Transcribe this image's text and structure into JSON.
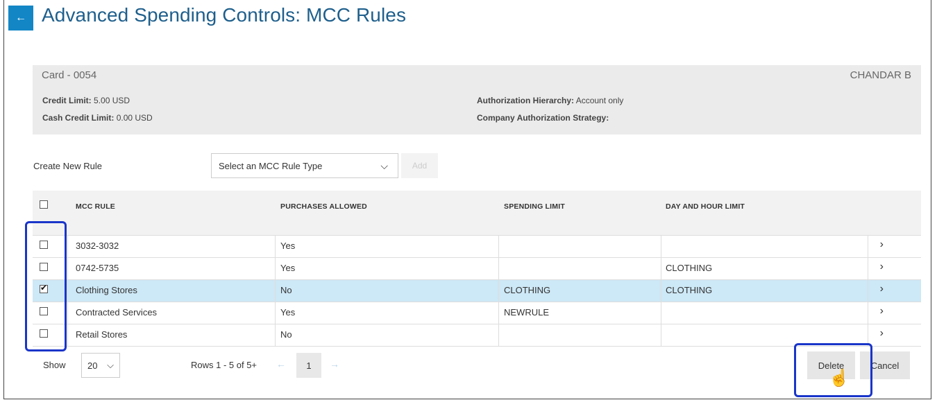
{
  "header": {
    "back_icon": "←",
    "title": "Advanced Spending Controls: MCC Rules"
  },
  "card": {
    "title": "Card - 0054",
    "holder": "CHANDAR B",
    "credit_limit_label": "Credit Limit:",
    "credit_limit_value": "5.00 USD",
    "cash_credit_limit_label": "Cash Credit Limit:",
    "cash_credit_limit_value": "0.00 USD",
    "auth_hierarchy_label": "Authorization Hierarchy:",
    "auth_hierarchy_value": "Account only",
    "company_strategy_label": "Company Authorization Strategy:",
    "company_strategy_value": ""
  },
  "create_rule": {
    "label": "Create New Rule",
    "select_value": "Select an MCC Rule Type",
    "add_label": "Add"
  },
  "table": {
    "columns": [
      "MCC RULE",
      "PURCHASES ALLOWED",
      "SPENDING LIMIT",
      "DAY AND HOUR LIMIT"
    ],
    "rows": [
      {
        "rule": "3032-3032",
        "purchases": "Yes",
        "spending": "",
        "dayhour": "",
        "checked": false
      },
      {
        "rule": "0742-5735",
        "purchases": "Yes",
        "spending": "",
        "dayhour": "CLOTHING",
        "checked": false
      },
      {
        "rule": "Clothing Stores",
        "purchases": "No",
        "spending": "CLOTHING",
        "dayhour": "CLOTHING",
        "checked": true
      },
      {
        "rule": "Contracted Services",
        "purchases": "Yes",
        "spending": "NEWRULE",
        "dayhour": "",
        "checked": false
      },
      {
        "rule": "Retail Stores",
        "purchases": "No",
        "spending": "",
        "dayhour": "",
        "checked": false
      }
    ]
  },
  "footer": {
    "show_label": "Show",
    "page_size": "20",
    "rows_info": "Rows 1 - 5 of 5+",
    "current_page": "1",
    "delete_label": "Delete",
    "cancel_label": "Cancel"
  },
  "colors": {
    "accent": "#1386c6",
    "title": "#1e5f8c",
    "selected_row": "#cde8f6",
    "highlight": "#1a35c9"
  }
}
